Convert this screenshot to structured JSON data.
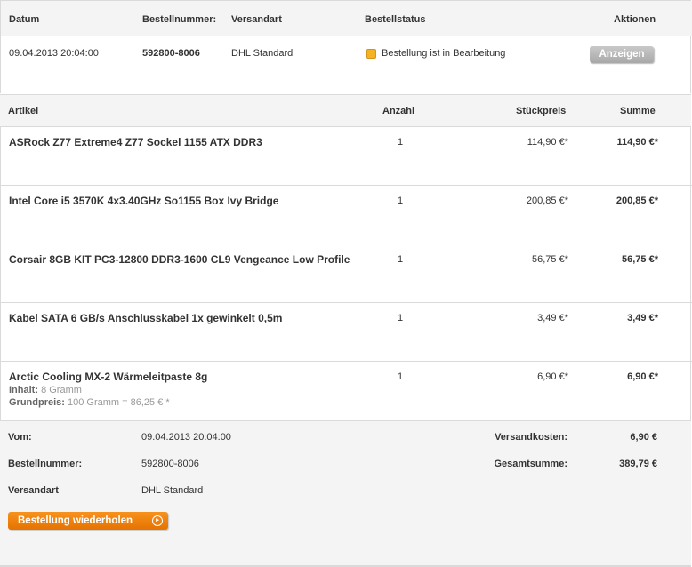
{
  "order_header": {
    "col_datum": "Datum",
    "col_bestellnummer": "Bestellnummer:",
    "col_versandart": "Versandart",
    "col_bestellstatus": "Bestellstatus",
    "col_aktionen": "Aktionen"
  },
  "order": {
    "datum": "09.04.2013 20:04:00",
    "bestellnummer": "592800-8006",
    "versandart": "DHL Standard",
    "status": "Bestellung ist in Bearbeitung",
    "status_color": "#f5b223",
    "show_button": "Anzeigen"
  },
  "items_header": {
    "artikel": "Artikel",
    "anzahl": "Anzahl",
    "stueckpreis": "Stückpreis",
    "summe": "Summe"
  },
  "items": [
    {
      "name": "ASRock Z77 Extreme4 Z77 Sockel 1155 ATX DDR3",
      "qty": "1",
      "price": "114,90 €*",
      "sum": "114,90 €*"
    },
    {
      "name": "Intel Core i5 3570K 4x3.40GHz So1155 Box Ivy Bridge",
      "qty": "1",
      "price": "200,85 €*",
      "sum": "200,85 €*"
    },
    {
      "name": "Corsair 8GB KIT PC3-12800 DDR3-1600 CL9 Vengeance Low Profile",
      "qty": "1",
      "price": "56,75 €*",
      "sum": "56,75 €*"
    },
    {
      "name": "Kabel SATA 6 GB/s Anschlusskabel 1x gewinkelt 0,5m",
      "qty": "1",
      "price": "3,49 €*",
      "sum": "3,49 €*"
    },
    {
      "name": "Arctic Cooling MX-2 Wärmeleitpaste 8g",
      "qty": "1",
      "price": "6,90 €*",
      "sum": "6,90 €*",
      "inhalt_label": "Inhalt:",
      "inhalt_value": "8 Gramm",
      "grundpreis_label": "Grundpreis:",
      "grundpreis_value": "100 Gramm = 86,25 € *"
    }
  ],
  "summary": {
    "vom_label": "Vom:",
    "vom_value": "09.04.2013 20:04:00",
    "bestellnummer_label": "Bestellnummer:",
    "bestellnummer_value": "592800-8006",
    "versandart_label": "Versandart",
    "versandart_value": "DHL Standard",
    "versandkosten_label": "Versandkosten:",
    "versandkosten_value": "6,90 €",
    "gesamtsumme_label": "Gesamtsumme:",
    "gesamtsumme_value": "389,79 €",
    "repeat_button": "Bestellung wiederholen",
    "accent_color": "#f7921e"
  }
}
